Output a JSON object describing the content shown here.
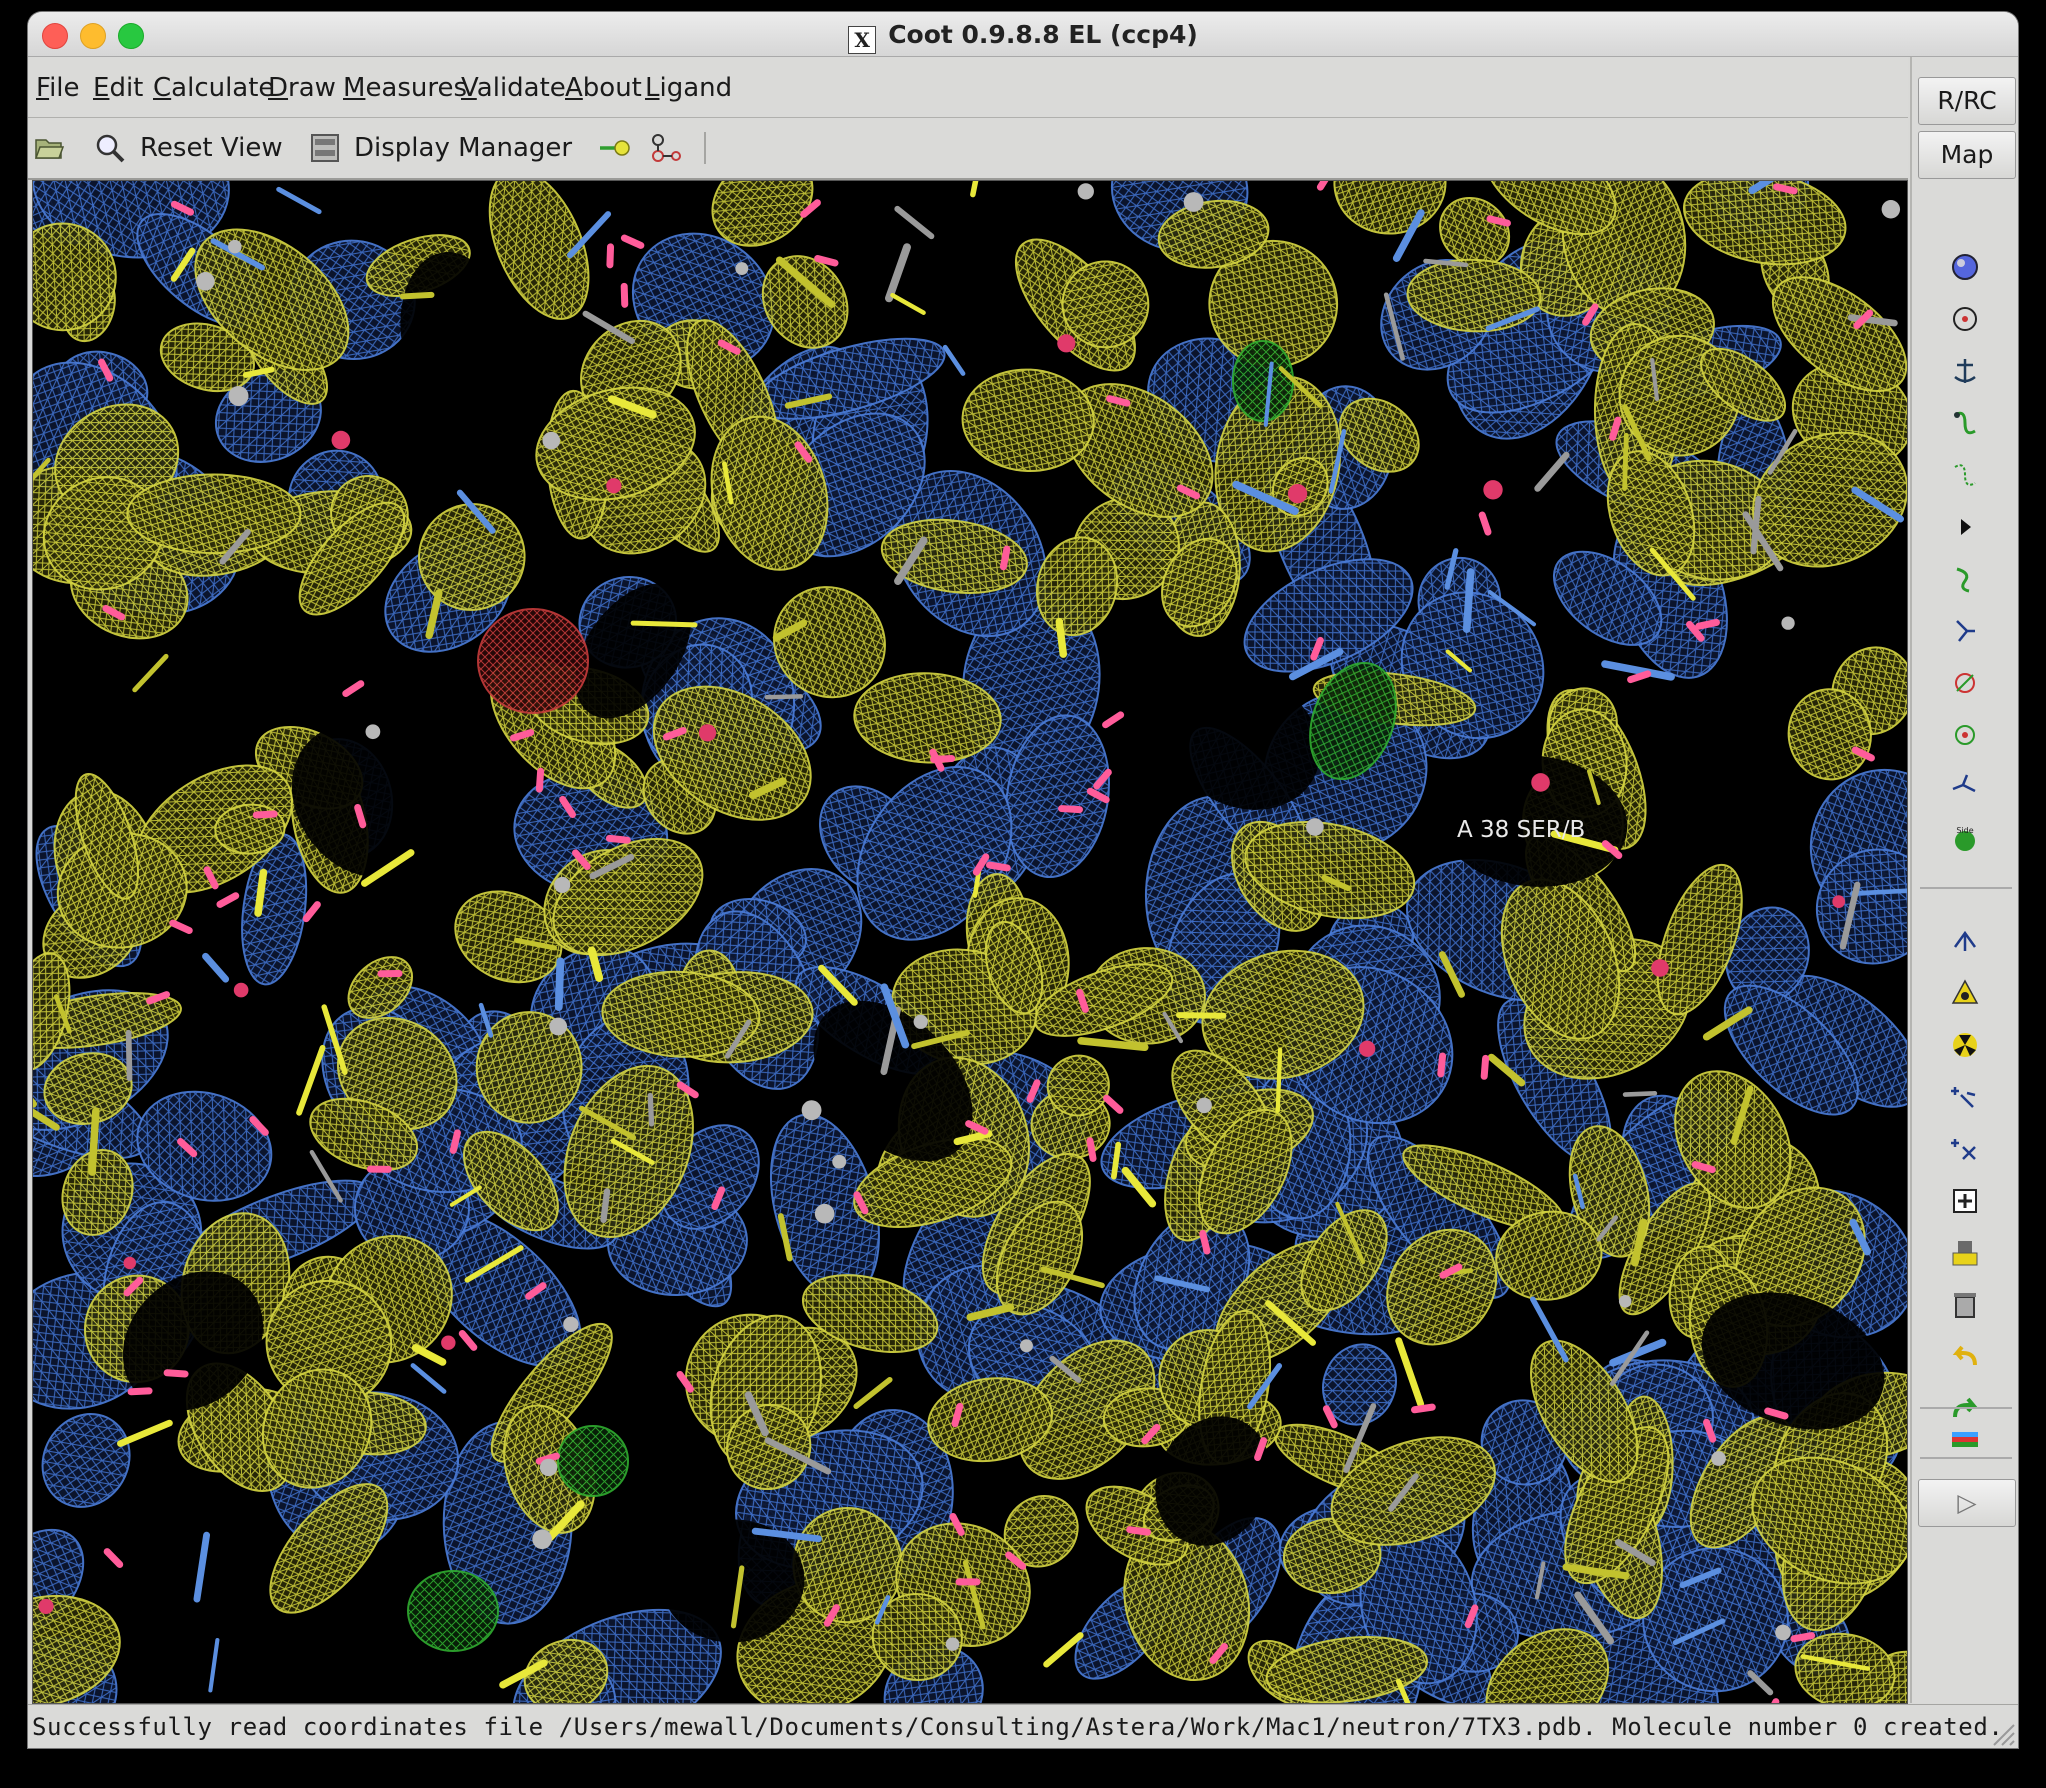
{
  "window": {
    "title": "Coot 0.9.8.8 EL (ccp4)",
    "title_icon": "x11-icon"
  },
  "menubar": {
    "items": [
      "File",
      "Edit",
      "Calculate",
      "Draw",
      "Measures",
      "Validate",
      "About",
      "Ligand"
    ]
  },
  "toolbar": {
    "open_icon": "folder-open-icon",
    "reset_view_label": "Reset View",
    "display_manager_label": "Display Manager",
    "extra_icons": [
      "go-to-atom-icon",
      "ligand-builder-icon"
    ]
  },
  "viewport": {
    "background": "#000000",
    "map_colors": {
      "map_1": "#c9c93a",
      "map_2": "#3f6fc9",
      "difference_negative": "#c23a3a",
      "difference_positive": "#2faa2f"
    },
    "atom_label": "A 38 SER/B"
  },
  "sidebar": {
    "rrc_label": "R/RC",
    "map_label": "Map",
    "tools": [
      "refine-sphere-icon",
      "regularize-icon",
      "rigid-body-fit-icon",
      "real-space-refine-icon",
      "rotamer-icon",
      "expand-arrow-icon",
      "flip-peptide-icon",
      "side-chain-180-icon",
      "edit-chi-angles-icon",
      "torsion-edit-icon",
      "backbone-torsion-icon",
      "side-chain-icon",
      "mutate-icon",
      "place-atom-icon",
      "delete-icon",
      "add-terminal-residue-icon",
      "add-alt-conf-icon",
      "clear-pending-icon",
      "pin-icon",
      "trash-icon",
      "undo-icon",
      "redo-icon",
      "toggle-bar-icon"
    ],
    "expand_label": "▷"
  },
  "statusbar": {
    "message": "Successfully read coordinates file /Users/mewall/Documents/Consulting/Astera/Work/Mac1/neutron/7TX3.pdb.  Molecule number 0 created."
  }
}
